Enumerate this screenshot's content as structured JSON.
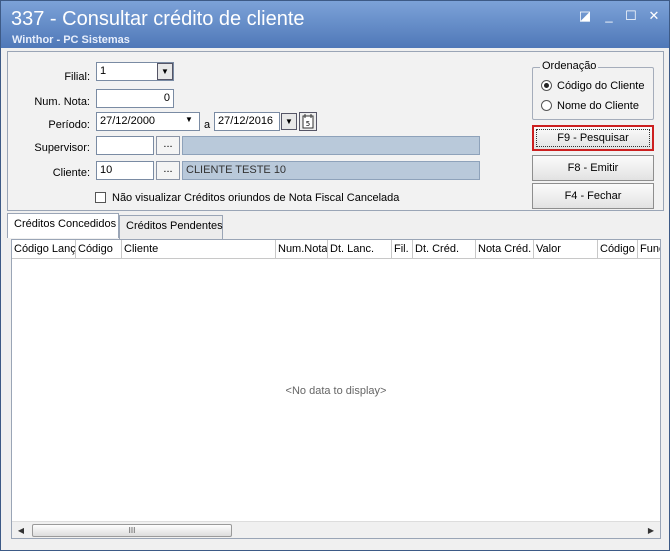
{
  "window": {
    "title": "337 - Consultar crédito de cliente",
    "subtitle": "Winthor - PC Sistemas",
    "controls": {
      "restore": "◪",
      "minimize": "_",
      "maximize": "☐",
      "close": "✕"
    }
  },
  "filters": {
    "filial_label": "Filial:",
    "filial_value": "1",
    "num_nota_label": "Num. Nota:",
    "num_nota_value": "0",
    "periodo_label": "Período:",
    "periodo_start": "27/12/2000",
    "periodo_sep": "a",
    "periodo_end": "27/12/2016",
    "supervisor_label": "Supervisor:",
    "supervisor_code": "",
    "supervisor_name": "",
    "cliente_label": "Cliente:",
    "cliente_code": "10",
    "cliente_name": "CLIENTE TESTE 10",
    "lookup_label": "...",
    "checkbox_label": "Não visualizar Créditos oriundos de Nota Fiscal Cancelada"
  },
  "ordenacao": {
    "legend": "Ordenação",
    "options": [
      "Código do Cliente",
      "Nome do Cliente"
    ],
    "selected": "Código do Cliente"
  },
  "buttons": {
    "pesquisar": "F9 - Pesquisar",
    "emitir": "F8 - Emitir",
    "fechar": "F4 - Fechar"
  },
  "tabs": [
    "Créditos Concedidos",
    "Créditos Pendentes"
  ],
  "grid": {
    "columns": [
      "Código Lanç",
      "Código",
      "Cliente",
      "Num.Nota",
      "Dt. Lanc.",
      "Fil.",
      "Dt. Créd.",
      "Nota Créd.",
      "Valor",
      "Código",
      "Func"
    ],
    "empty_text": "<No data to display>",
    "scroll_grip": "III"
  },
  "colors": {
    "title_bar": "#5a82c0",
    "focus_border": "#cc1f1f",
    "readonly_field": "#b9c9da"
  }
}
